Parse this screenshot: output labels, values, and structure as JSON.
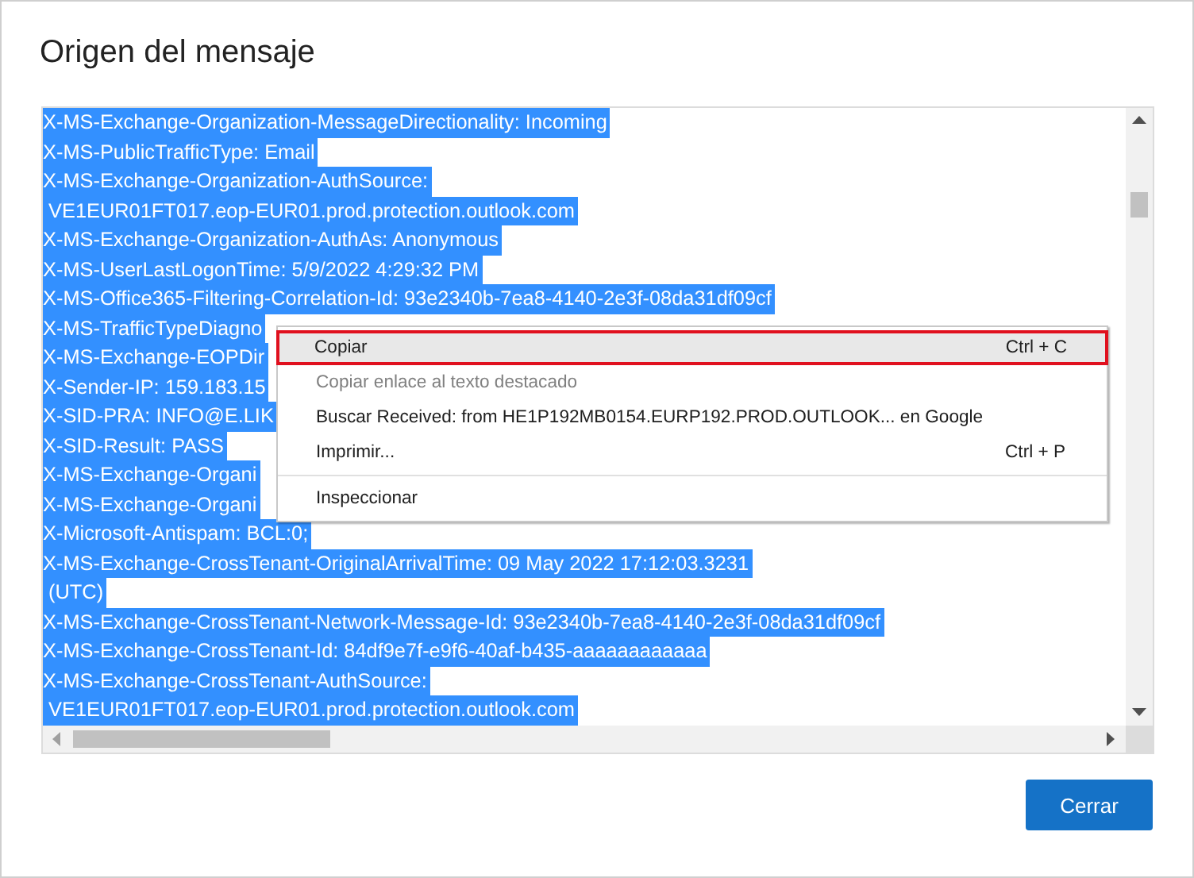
{
  "dialog": {
    "title": "Origen del mensaje"
  },
  "source_view": {
    "lines": [
      {
        "text": "X-MS-Exchange-Organization-MessageDirectionality: Incoming",
        "selected": true
      },
      {
        "text": "X-MS-PublicTrafficType: Email",
        "selected": true
      },
      {
        "text": "X-MS-Exchange-Organization-AuthSource:",
        "selected": true
      },
      {
        "text": " VE1EUR01FT017.eop-EUR01.prod.protection.outlook.com",
        "selected": true
      },
      {
        "text": "X-MS-Exchange-Organization-AuthAs: Anonymous",
        "selected": true
      },
      {
        "text": "X-MS-UserLastLogonTime: 5/9/2022 4:29:32 PM",
        "selected": true
      },
      {
        "text": "X-MS-Office365-Filtering-Correlation-Id: 93e2340b-7ea8-4140-2e3f-08da31df09cf",
        "selected": true
      },
      {
        "text": "X-MS-TrafficTypeDiagno",
        "selected": true
      },
      {
        "text": "X-MS-Exchange-EOPDir",
        "selected": true
      },
      {
        "text": "X-Sender-IP: 159.183.15",
        "selected": true
      },
      {
        "text": "X-SID-PRA: INFO@E.LIK",
        "selected": true
      },
      {
        "text": "X-SID-Result: PASS",
        "selected": true
      },
      {
        "text": "X-MS-Exchange-Organi",
        "selected": true
      },
      {
        "text": "X-MS-Exchange-Organi",
        "selected": true
      },
      {
        "text": "X-Microsoft-Antispam: BCL:0;",
        "selected": true
      },
      {
        "text": "X-MS-Exchange-CrossTenant-OriginalArrivalTime: 09 May 2022 17:12:03.3231",
        "selected": true
      },
      {
        "text": " (UTC)",
        "selected": true
      },
      {
        "text": "X-MS-Exchange-CrossTenant-Network-Message-Id: 93e2340b-7ea8-4140-2e3f-08da31df09cf",
        "selected": true
      },
      {
        "text": "X-MS-Exchange-CrossTenant-Id: 84df9e7f-e9f6-40af-b435-aaaaaaaaaaaa",
        "selected": true
      },
      {
        "text": "X-MS-Exchange-CrossTenant-AuthSource:",
        "selected": true
      },
      {
        "text": " VE1EUR01FT017.eop-EUR01.prod.protection.outlook.com",
        "selected": true
      }
    ]
  },
  "context_menu": {
    "items": [
      {
        "kind": "item",
        "label": "Copiar",
        "shortcut": "Ctrl + C",
        "selected": true,
        "disabled": false
      },
      {
        "kind": "item",
        "label": "Copiar enlace al texto destacado",
        "selected": false,
        "disabled": true
      },
      {
        "kind": "item",
        "label": "Buscar Received: from HE1P192MB0154.EURP192.PROD.OUTLOOK... en Google",
        "selected": false,
        "disabled": false
      },
      {
        "kind": "item",
        "label": "Imprimir...",
        "shortcut": "Ctrl + P",
        "selected": false,
        "disabled": false
      },
      {
        "kind": "separator"
      },
      {
        "kind": "item",
        "label": "Inspeccionar",
        "selected": false,
        "disabled": false
      }
    ]
  },
  "buttons": [
    {
      "label": "Cerrar"
    }
  ]
}
